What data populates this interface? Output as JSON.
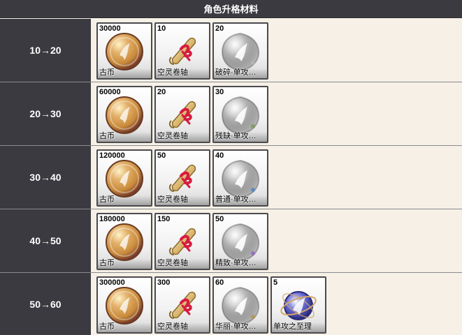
{
  "header": {
    "title": "角色升格材料"
  },
  "rows": [
    {
      "level": "10→20",
      "items": [
        {
          "qty": "30000",
          "name": "古币",
          "icon": "coin-icon",
          "color": "#c98a3a"
        },
        {
          "qty": "10",
          "name": "空灵卷轴",
          "icon": "scroll-icon",
          "color": "#d8b36a"
        },
        {
          "qty": "20",
          "name": "破碎·单攻…",
          "icon": "wax-seal-icon",
          "color": "#b9b9b9"
        }
      ]
    },
    {
      "level": "20→30",
      "items": [
        {
          "qty": "60000",
          "name": "古币",
          "icon": "coin-icon",
          "color": "#c98a3a"
        },
        {
          "qty": "20",
          "name": "空灵卷轴",
          "icon": "scroll-icon",
          "color": "#d8b36a"
        },
        {
          "qty": "30",
          "name": "残缺·单攻…",
          "icon": "wax-seal-icon",
          "color": "#6f8f3b"
        }
      ]
    },
    {
      "level": "30→40",
      "items": [
        {
          "qty": "120000",
          "name": "古币",
          "icon": "coin-icon",
          "color": "#c98a3a"
        },
        {
          "qty": "50",
          "name": "空灵卷轴",
          "icon": "scroll-icon",
          "color": "#d8b36a"
        },
        {
          "qty": "40",
          "name": "普通·单攻…",
          "icon": "wax-seal-icon",
          "color": "#2f74c9"
        }
      ]
    },
    {
      "level": "40→50",
      "items": [
        {
          "qty": "180000",
          "name": "古币",
          "icon": "coin-icon",
          "color": "#c98a3a"
        },
        {
          "qty": "150",
          "name": "空灵卷轴",
          "icon": "scroll-icon",
          "color": "#d8b36a"
        },
        {
          "qty": "50",
          "name": "精致·单攻…",
          "icon": "wax-seal-icon",
          "color": "#8a4fc6"
        }
      ]
    },
    {
      "level": "50→60",
      "items": [
        {
          "qty": "300000",
          "name": "古币",
          "icon": "coin-icon",
          "color": "#c98a3a"
        },
        {
          "qty": "300",
          "name": "空灵卷轴",
          "icon": "scroll-icon",
          "color": "#d8b36a"
        },
        {
          "qty": "60",
          "name": "华丽·单攻…",
          "icon": "wax-seal-icon",
          "color": "#b88a2e"
        },
        {
          "qty": "5",
          "name": "单攻之至理",
          "icon": "orb-icon",
          "color": "#6a6fd6"
        }
      ]
    }
  ]
}
